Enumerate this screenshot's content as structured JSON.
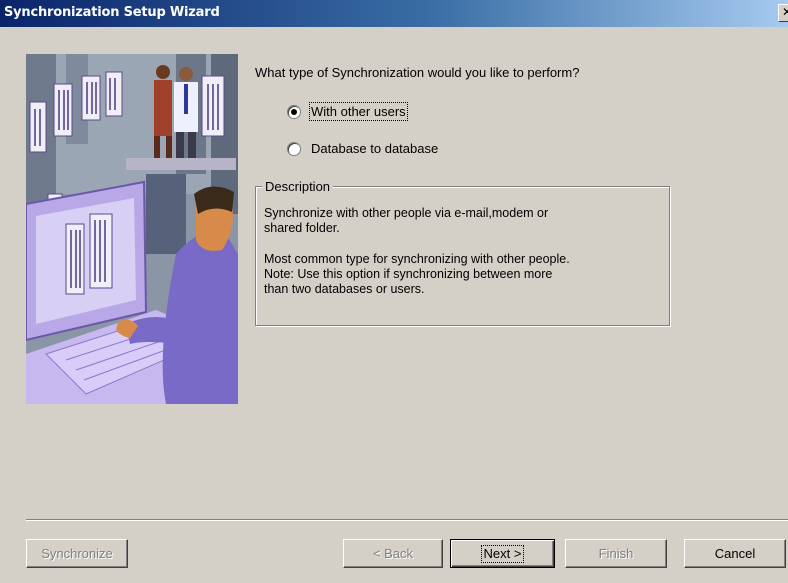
{
  "window": {
    "title": "Synchronization Setup Wizard",
    "close_icon": "close-icon"
  },
  "wizard": {
    "question": "What type of Synchronization would you like to perform?",
    "options": [
      {
        "label": "With other users",
        "access_key": "W",
        "selected": true
      },
      {
        "label": "Database to database",
        "access_key": "D",
        "selected": false
      }
    ]
  },
  "description": {
    "legend": "Description",
    "line1": "Synchronize with other people via e-mail,modem or",
    "line2": "shared folder.",
    "line3": "Most common type for synchronizing with other people.",
    "line4": "Note: Use this option if synchronizing between more",
    "line5": "than two databases or users."
  },
  "buttons": {
    "synchronize": "Synchronize",
    "back": "< Back",
    "next": "Next >",
    "finish": "Finish",
    "cancel": "Cancel"
  },
  "colors": {
    "titlebar_start": "#0a246a",
    "titlebar_end": "#a6caf0",
    "dialog_bg": "#d4d0c8",
    "illustration_purple": "#a08cd8"
  }
}
